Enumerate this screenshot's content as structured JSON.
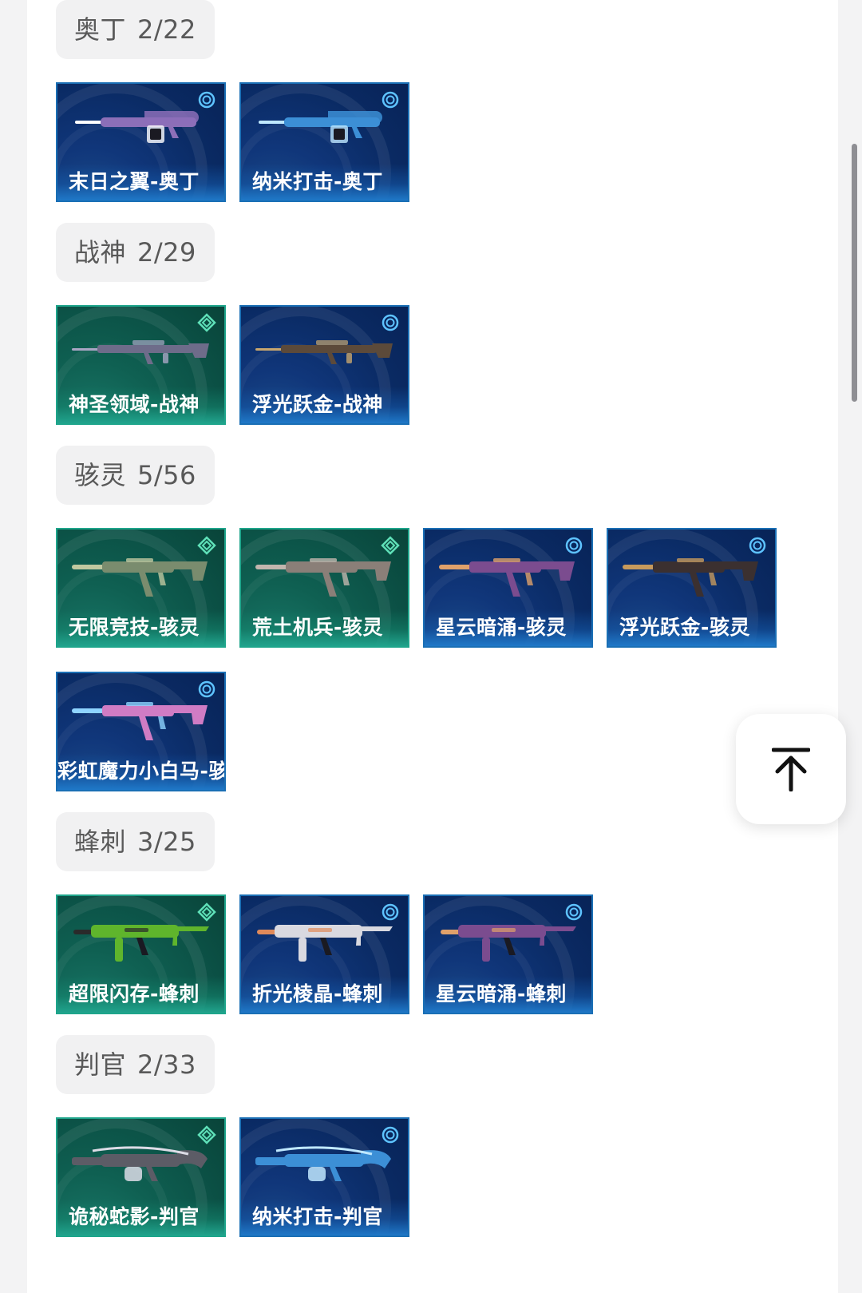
{
  "groups": [
    {
      "name": "奥丁",
      "count": "2/22",
      "skins": [
        {
          "label": "末日之翼-奥丁",
          "tier": "blue",
          "gun": "lmg",
          "gun_color": "#8c6fb8",
          "accent": "#ffffff"
        },
        {
          "label": "纳米打击-奥丁",
          "tier": "blue",
          "gun": "lmg",
          "gun_color": "#3c8fd6",
          "accent": "#bfe8ff"
        }
      ]
    },
    {
      "name": "战神",
      "count": "2/29",
      "skins": [
        {
          "label": "神圣领域-战神",
          "tier": "green",
          "gun": "rifle",
          "gun_color": "#6e6c8a",
          "accent": "#a9a6c4"
        },
        {
          "label": "浮光跃金-战神",
          "tier": "blue",
          "gun": "rifle",
          "gun_color": "#5c4a3a",
          "accent": "#c8a66e"
        }
      ]
    },
    {
      "name": "骇灵",
      "count": "5/56",
      "skins": [
        {
          "label": "无限竞技-骇灵",
          "tier": "green",
          "gun": "smg",
          "gun_color": "#7a8c6e",
          "accent": "#c0c8a0"
        },
        {
          "label": "荒土机兵-骇灵",
          "tier": "green",
          "gun": "smg",
          "gun_color": "#8a7f78",
          "accent": "#c2b6ae"
        },
        {
          "label": "星云暗涌-骇灵",
          "tier": "blue",
          "gun": "smg",
          "gun_color": "#7b4c8f",
          "accent": "#e0a16a"
        },
        {
          "label": "浮光跃金-骇灵",
          "tier": "blue",
          "gun": "smg",
          "gun_color": "#3b3030",
          "accent": "#c79a5c"
        },
        {
          "label": "彩虹魔力小白马-骇灵",
          "tier": "blue",
          "gun": "smg",
          "gun_color": "#d07cc4",
          "accent": "#8fd4ff"
        }
      ]
    },
    {
      "name": "蜂刺",
      "count": "3/25",
      "skins": [
        {
          "label": "超限闪存-蜂刺",
          "tier": "green",
          "gun": "spectre",
          "gun_color": "#5fb52c",
          "accent": "#2a2a2a"
        },
        {
          "label": "折光棱晶-蜂刺",
          "tier": "blue",
          "gun": "spectre",
          "gun_color": "#d9d9e0",
          "accent": "#e08a5a"
        },
        {
          "label": "星云暗涌-蜂刺",
          "tier": "blue",
          "gun": "spectre",
          "gun_color": "#7b4c8f",
          "accent": "#e0a16a"
        }
      ]
    },
    {
      "name": "判官",
      "count": "2/33",
      "skins": [
        {
          "label": "诡秘蛇影-判官",
          "tier": "green",
          "gun": "shotgun",
          "gun_color": "#5c5c66",
          "accent": "#dcdce6"
        },
        {
          "label": "纳米打击-判官",
          "tier": "blue",
          "gun": "shotgun",
          "gun_color": "#3c8fd6",
          "accent": "#bfe8ff"
        }
      ]
    }
  ],
  "icons": {
    "back_to_top": "arrow-up-to-line-icon",
    "rarity_blue": "circle-ring-icon",
    "rarity_green": "diamond-icon"
  },
  "colors": {
    "tier_blue_bg": "#0a2a63",
    "tier_green_bg": "#0b4f44",
    "chip_bg": "#f1f1f2",
    "chip_text": "#595959"
  }
}
